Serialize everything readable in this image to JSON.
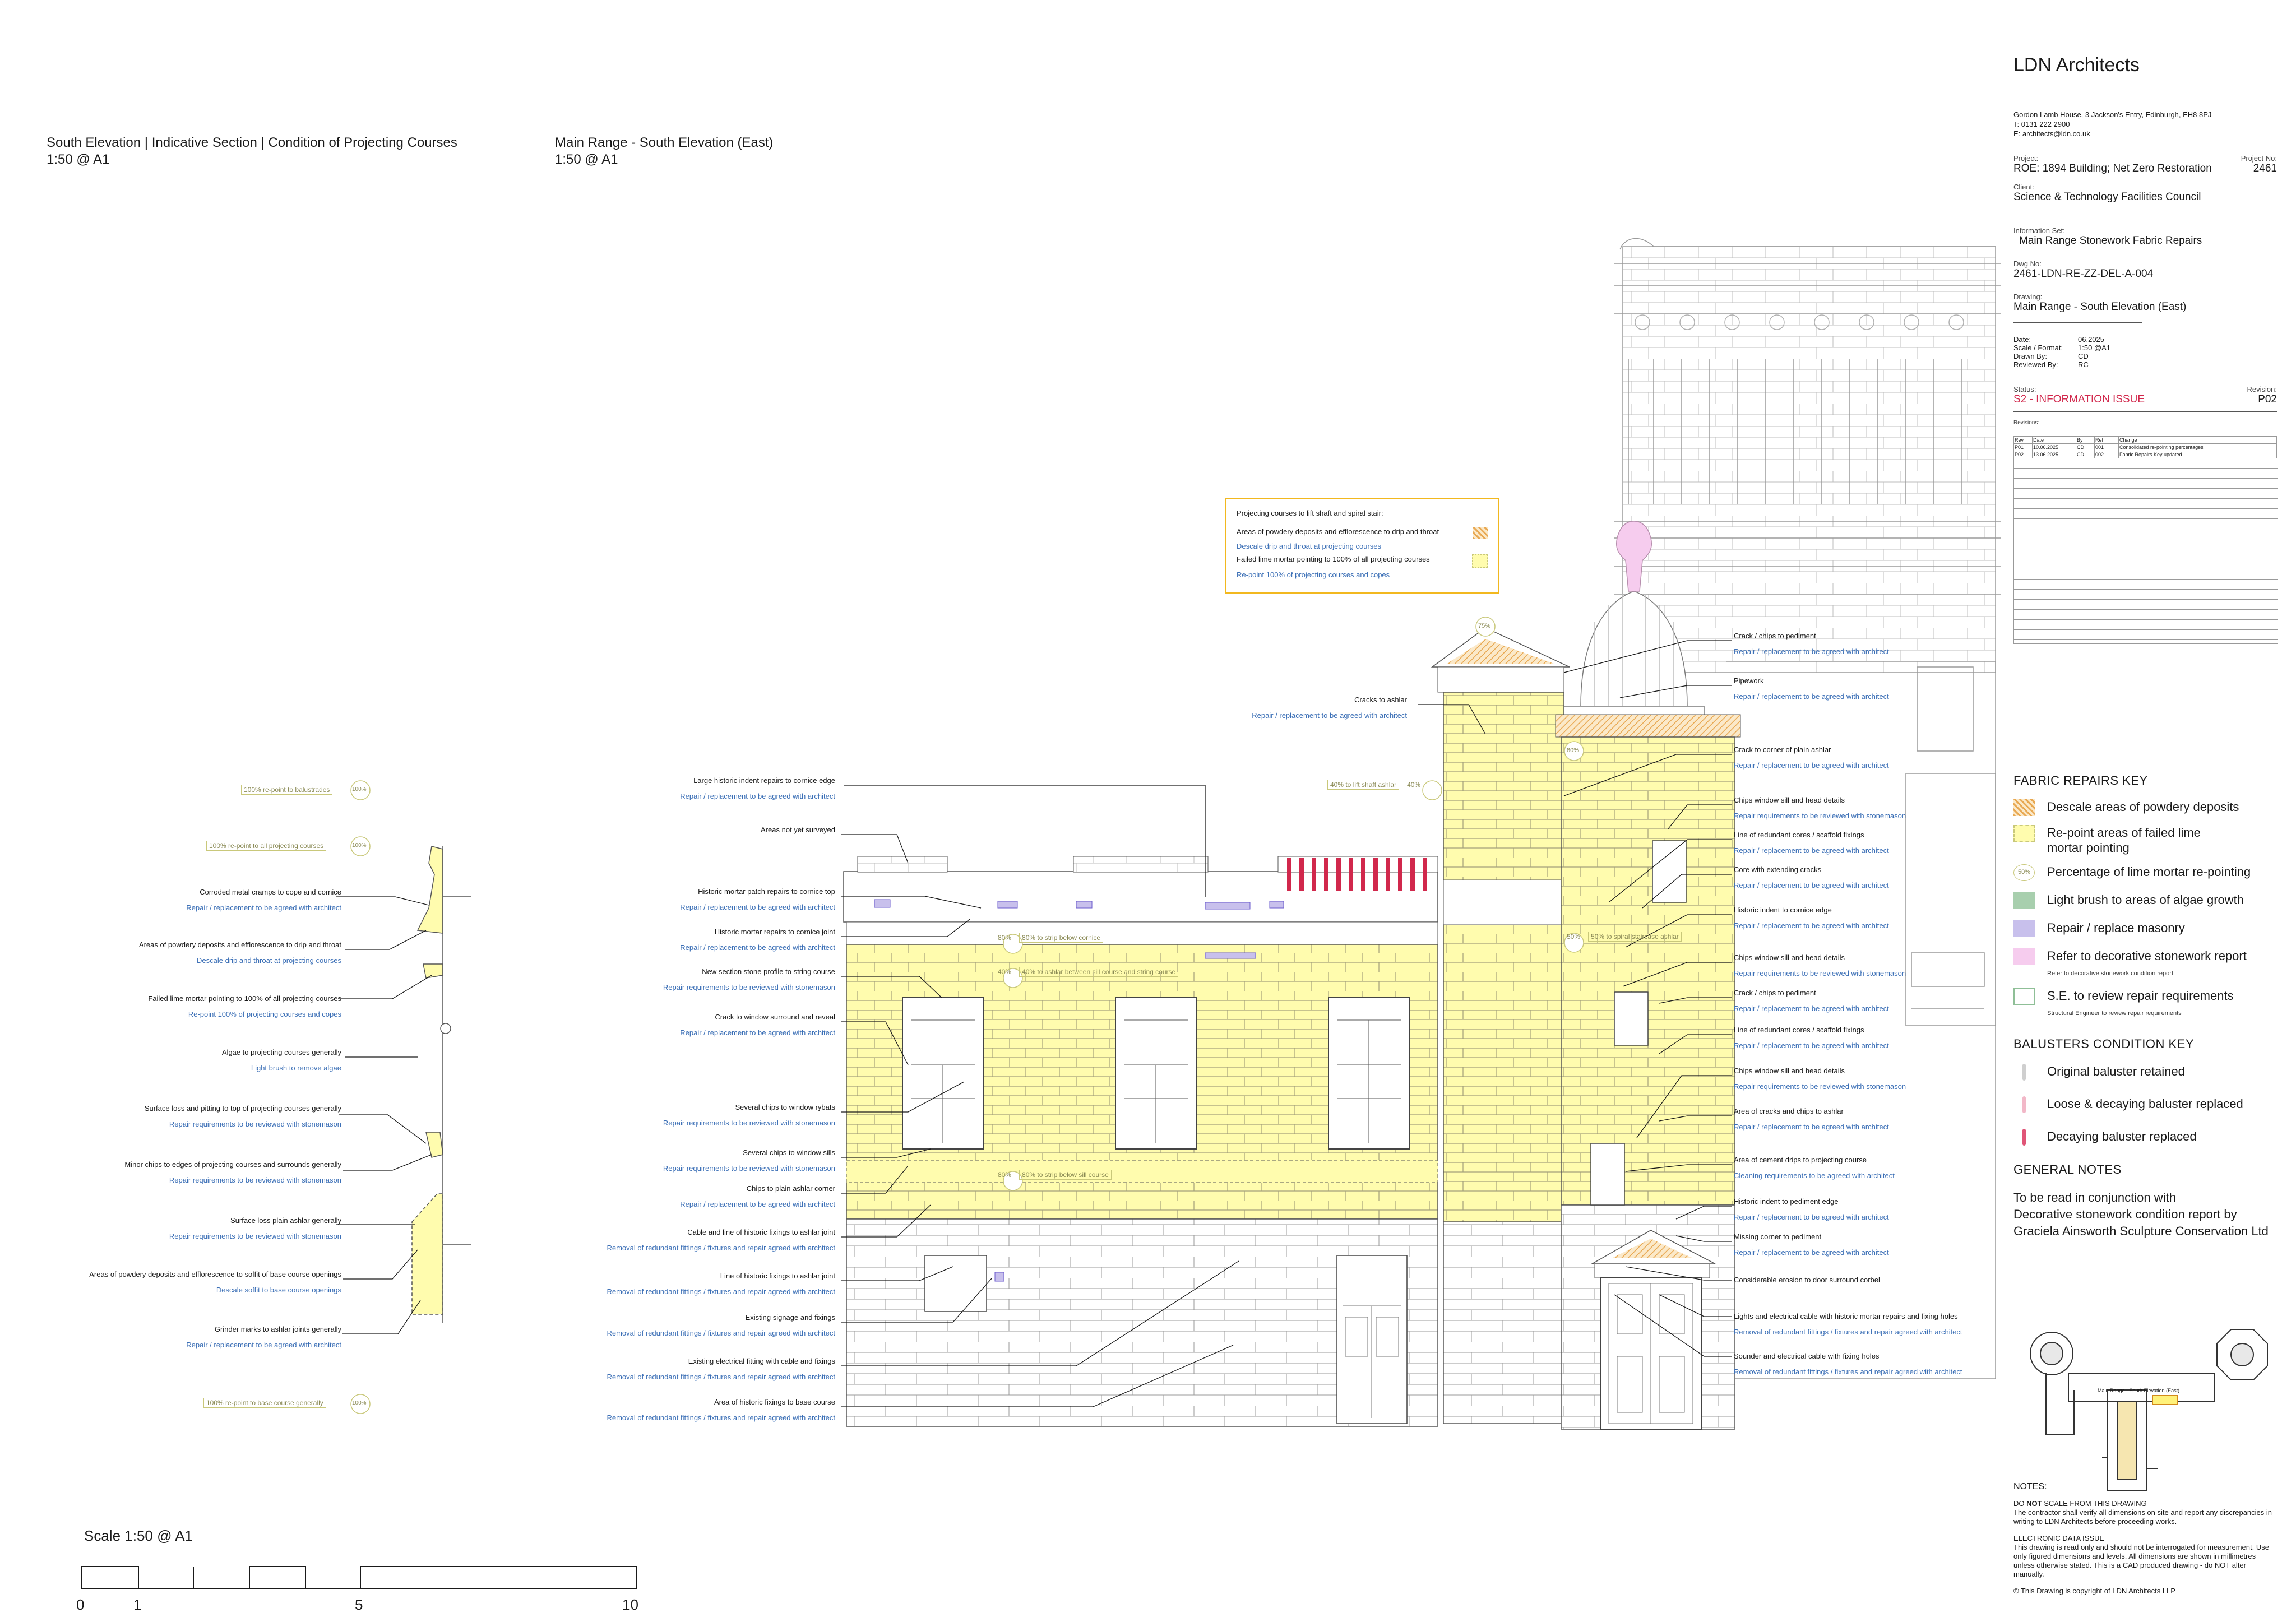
{
  "titles": {
    "section_title": "South Elevation | Indicative Section | Condition of Projecting Courses",
    "section_scale": "1:50 @ A1",
    "elevation_title": "Main Range - South Elevation (East)",
    "elevation_scale": "1:50 @ A1"
  },
  "title_block": {
    "firm": "LDN Architects",
    "address": [
      "Gordon Lamb House, 3 Jackson's Entry, Edinburgh, EH8 8PJ",
      "T: 0131 222 2900",
      "E: architects@ldn.co.uk"
    ],
    "project_label": "Project:",
    "project": "ROE: 1894 Building; Net Zero Restoration",
    "project_no_label": "Project No:",
    "project_no": "2461",
    "client_label": "Client:",
    "client": "Science & Technology Facilities Council",
    "info_set_label": "Information Set:",
    "info_set": "Main Range Stonework Fabric Repairs",
    "dwg_no_label": "Dwg No:",
    "dwg_no": "2461-LDN-RE-ZZ-DEL-A-004",
    "drawing_label": "Drawing:",
    "drawing": "Main Range - South Elevation (East)",
    "meta": [
      {
        "label": "Date:",
        "value": "06.2025"
      },
      {
        "label": "Scale / Format:",
        "value": "1:50 @A1"
      },
      {
        "label": "Drawn By:",
        "value": "CD"
      },
      {
        "label": "Reviewed By:",
        "value": "RC"
      }
    ],
    "status_label": "Status:",
    "status": "S2 - INFORMATION ISSUE",
    "revision_label": "Revision:",
    "revision": "P02",
    "revisions_label": "Revisions:",
    "rev_headers": [
      "Rev",
      "Date",
      "By",
      "Ref",
      "Change"
    ],
    "rev_rows": [
      [
        "P01",
        "10.06.2025",
        "CD",
        "001",
        "Consolidated re-pointing percentages"
      ],
      [
        "P02",
        "13.06.2025",
        "CD",
        "002",
        "Fabric Repairs Key updated"
      ]
    ]
  },
  "fabric_key": {
    "heading": "FABRIC REPAIRS KEY",
    "items": [
      {
        "label": "Descale areas of powdery deposits",
        "swatch": "hatch",
        "color": "#e8b26a"
      },
      {
        "label": "Re-point areas of failed lime mortar pointing",
        "swatch": "dashed",
        "color": "#fffcae"
      },
      {
        "label": "Percentage of lime mortar re-pointing",
        "swatch": "circle",
        "color": "#c9c87a",
        "circle_text": "50%"
      },
      {
        "label": "Light brush to areas of algae growth",
        "swatch": "fill",
        "color": "#a8cfae"
      },
      {
        "label": "Repair / replace masonry",
        "swatch": "fill",
        "color": "#c8c0ec"
      },
      {
        "label": "Refer to decorative stonework report",
        "sub": "Refer to decorative stonework condition report",
        "swatch": "fill",
        "color": "#f6ccee"
      },
      {
        "label": "S.E. to review repair requirements",
        "sub": "Structural Engineer to review repair requirements",
        "swatch": "outline",
        "color": "#8fbf97"
      }
    ]
  },
  "baluster_key": {
    "heading": "BALUSTERS CONDITION KEY",
    "items": [
      {
        "label": "Original baluster retained",
        "color": "#cfcfcf"
      },
      {
        "label": "Loose & decaying baluster replaced",
        "color": "#f2b8c8"
      },
      {
        "label": "Decaying baluster replaced",
        "color": "#e05577"
      }
    ]
  },
  "general_notes": {
    "heading": "GENERAL NOTES",
    "text": [
      "To be read in conjunction with",
      "Decorative stonework condition report by",
      "Graciela Ainsworth Sculpture Conservation Ltd"
    ]
  },
  "keyplan_label": "Main Range - South Elevation (East)",
  "notes": {
    "heading": "NOTES:",
    "do_not_scale_pre": "DO ",
    "do_not_scale_not": "NOT",
    "do_not_scale_post": " SCALE FROM THIS DRAWING",
    "verify": "The contractor shall verify all dimensions on site and report any discrepancies in writing to LDN Architects before proceeding works.",
    "edi_heading": "ELECTRONIC DATA ISSUE",
    "edi": "This drawing is read only and should not be interrogated for measurement. Use only figured dimensions and levels. All dimensions are shown in millimetres unless otherwise stated. This is a CAD produced drawing - do NOT alter manually.",
    "copyright": "© This Drawing is copyright of LDN Architects LLP"
  },
  "scale_bar": {
    "title": "Scale 1:50 @ A1",
    "ticks": [
      "0",
      "1",
      "5",
      "10"
    ]
  },
  "legend_box": {
    "title": "Projecting courses to lift shaft and spiral stair:",
    "line1": "Areas of powdery deposits and efflorescence to drip and throat",
    "line1_action": "Descale drip and throat at projecting courses",
    "line2": "Failed lime mortar pointing to 100% of all projecting courses",
    "line2_action": "Re-point 100% of projecting courses and copes"
  },
  "section_notes": [
    {
      "l1": "Corroded metal cramps to cope and cornice",
      "l2": "Repair / replacement to be agreed with architect"
    },
    {
      "l1": "Areas of powdery deposits and efflorescence to drip and throat",
      "l2": "Descale drip and throat at projecting courses"
    },
    {
      "l1": "Failed lime mortar pointing to 100% of all projecting courses",
      "l2": "Re-point 100% of projecting courses and copes"
    },
    {
      "l1": "Algae to projecting courses generally",
      "l2": "Light brush to remove algae"
    },
    {
      "l1": "Surface loss and pitting to top of projecting courses generally",
      "l2": "Repair requirements to be reviewed with stonemason"
    },
    {
      "l1": "Minor chips to edges of projecting courses and surrounds generally",
      "l2": "Repair requirements to be reviewed with stonemason"
    },
    {
      "l1": "Surface loss plain ashlar generally",
      "l2": "Repair requirements to be reviewed with stonemason"
    },
    {
      "l1": "Areas of powdery deposits and efflorescence to soffit of base course openings",
      "l2": "Descale soffit to base course openings"
    },
    {
      "l1": "Grinder marks to ashlar joints generally",
      "l2": "Repair / replacement to be agreed with architect"
    }
  ],
  "section_tags": [
    "100% re-point to balustrades",
    "100% re-point to all projecting courses",
    "100% re-point to base course generally"
  ],
  "left_notes": [
    {
      "l1": "Large historic indent repairs to cornice edge",
      "l2": "Repair / replacement to be agreed with architect"
    },
    {
      "l1": "Areas not yet surveyed",
      "l2": ""
    },
    {
      "l1": "Historic mortar patch repairs to cornice top",
      "l2": "Repair / replacement to be agreed with architect"
    },
    {
      "l1": "Historic mortar repairs to cornice joint",
      "l2": "Repair / replacement to be agreed with architect"
    },
    {
      "l1": "New section stone profile to string course",
      "l2": "Repair requirements to be reviewed with stonemason"
    },
    {
      "l1": "Crack to window surround and reveal",
      "l2": "Repair / replacement to be agreed with architect"
    },
    {
      "l1": "Several chips to window rybats",
      "l2": "Repair requirements to be reviewed with stonemason"
    },
    {
      "l1": "Several chips to window sills",
      "l2": "Repair requirements to be reviewed with stonemason"
    },
    {
      "l1": "Chips to plain ashlar corner",
      "l2": "Repair / replacement to be agreed with architect"
    },
    {
      "l1": "Cable and line of historic fixings to ashlar joint",
      "l2": "Removal of redundant fittings / fixtures and repair agreed with architect"
    },
    {
      "l1": "Line of historic fixings to ashlar joint",
      "l2": "Removal of redundant fittings / fixtures and repair agreed with architect"
    },
    {
      "l1": "Existing signage and fixings",
      "l2": "Removal of redundant fittings / fixtures and repair agreed with architect"
    },
    {
      "l1": "Existing electrical fitting with cable and fixings",
      "l2": "Removal of redundant fittings / fixtures and repair agreed with architect"
    },
    {
      "l1": "Area of historic fixings to base course",
      "l2": "Removal of redundant fittings / fixtures and repair agreed with architect"
    }
  ],
  "top_note": {
    "l1": "Cracks to ashlar",
    "l2": "Repair / replacement to be agreed with architect"
  },
  "right_notes": [
    {
      "l1": "Crack / chips to pediment",
      "l2": "Repair / replacement to be agreed with architect"
    },
    {
      "l1": "Pipework",
      "l2": "Repair / replacement to be agreed with architect"
    },
    {
      "l1": "Crack to corner of plain ashlar",
      "l2": "Repair / replacement to be agreed with architect"
    },
    {
      "l1": "Chips window sill and head details",
      "l2": "Repair requirements to be reviewed with stonemason"
    },
    {
      "l1": "Line of redundant cores / scaffold fixings",
      "l2": "Repair / replacement to be agreed with architect"
    },
    {
      "l1": "Core with extending cracks",
      "l2": "Repair / replacement to be agreed with architect"
    },
    {
      "l1": "Historic indent to cornice edge",
      "l2": "Repair / replacement to be agreed with architect"
    },
    {
      "l1": "Chips window sill and head details",
      "l2": "Repair requirements to be reviewed with stonemason"
    },
    {
      "l1": "Crack / chips to pediment",
      "l2": "Repair / replacement to be agreed with architect"
    },
    {
      "l1": "Line of redundant cores / scaffold fixings",
      "l2": "Repair / replacement to be agreed with architect"
    },
    {
      "l1": "Chips window sill and head details",
      "l2": "Repair requirements to be reviewed with stonemason"
    },
    {
      "l1": "Area of cracks and chips to ashlar",
      "l2": "Repair / replacement to be agreed with architect"
    },
    {
      "l1": "Area of cement drips to projecting course",
      "l2": "Cleaning requirements to be agreed with architect"
    },
    {
      "l1": "Historic indent to pediment edge",
      "l2": "Repair / replacement to be agreed with architect"
    },
    {
      "l1": "Missing corner to pediment",
      "l2": "Repair / replacement to be agreed with architect"
    },
    {
      "l1": "Considerable erosion to door surround corbel",
      "l2": ""
    },
    {
      "l1": "Lights and electrical cable with historic mortar repairs and fixing holes",
      "l2": "Removal of redundant fittings / fixtures and repair agreed with architect"
    },
    {
      "l1": "Sounder and electrical cable with fixing holes",
      "l2": "Removal of redundant fittings / fixtures and repair agreed with architect"
    }
  ],
  "elevation_tags": [
    {
      "text": "80% to strip below cornice",
      "pct": "80%"
    },
    {
      "text": "40% to ashlar between sill course and string course",
      "pct": "40%"
    },
    {
      "text": "80% to strip below sill course",
      "pct": "80%"
    },
    {
      "text": "40% to lift shaft ashlar",
      "pct": "40%"
    },
    {
      "text": "50% to spiral staircase ashlar",
      "pct": "50%"
    }
  ],
  "pct_circles": [
    "75%",
    "80%",
    "100%",
    "100%",
    "100%"
  ]
}
